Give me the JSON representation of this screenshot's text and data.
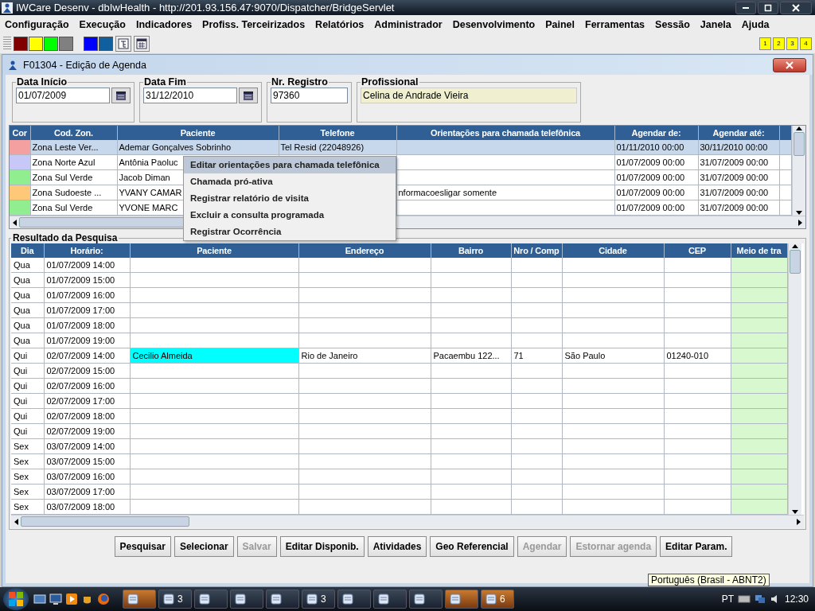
{
  "window": {
    "title": "IWCare Desenv - dbIwHealth - http://201.93.156.47:9070/Dispatcher/BridgeServlet"
  },
  "menu": [
    "Configuração",
    "Execução",
    "Indicadores",
    "Profiss. Terceirizados",
    "Relatórios",
    "Administrador",
    "Desenvolvimento",
    "Painel",
    "Ferramentas",
    "Sessão",
    "Janela",
    "Ajuda"
  ],
  "toolbar": {
    "swatches": [
      {
        "color": "#800000"
      },
      {
        "color": "#ffff00"
      },
      {
        "color": "#00ff00"
      },
      {
        "color": "#808080"
      },
      {
        "color": "#0000ff"
      },
      {
        "color": "#1060a0"
      }
    ],
    "pages": [
      "1",
      "2",
      "3",
      "4"
    ]
  },
  "inner_window": {
    "title": "F01304 - Edição de Agenda"
  },
  "filters": [
    {
      "label": "Data Início",
      "value": "01/07/2009",
      "kind": "date"
    },
    {
      "label": "Data Fim",
      "value": "31/12/2010",
      "kind": "date"
    },
    {
      "label": "Nr. Registro",
      "value": "97360",
      "kind": "text"
    },
    {
      "label": "Profissional",
      "value": "Celina de Andrade Vieira",
      "kind": "readonly"
    }
  ],
  "schedule_table": {
    "columns": [
      "Cor",
      "Cod. Zon.",
      "Paciente",
      "Telefone",
      "Orientações para chamada telefônica",
      "Agendar de:",
      "Agendar até:"
    ],
    "rows": [
      {
        "selected": true,
        "color": "#f4a0a0",
        "zone": "Zona Leste Ver...",
        "patient": "Ademar Gonçalves Sobrinho",
        "phone": "Tel Resid (22048926)",
        "notes": "",
        "from": "01/11/2010 00:00",
        "to": "30/11/2010 00:00"
      },
      {
        "selected": false,
        "color": "#c8c8f8",
        "zone": "Zona Norte Azul",
        "patient": "Antônia Paoluc",
        "phone": "",
        "notes": "",
        "from": "01/07/2009 00:00",
        "to": "31/07/2009 00:00"
      },
      {
        "selected": false,
        "color": "#90ee90",
        "zone": "Zona Sul Verde",
        "patient": "Jacob Diman",
        "phone": "",
        "notes": "",
        "from": "01/07/2009 00:00",
        "to": "31/07/2009 00:00"
      },
      {
        "selected": false,
        "color": "#ffc878",
        "zone": "Zona Sudoeste ...",
        "patient": "YVANY CAMAR",
        "phone": "",
        "notes": "nformacoesligar somente",
        "from": "01/07/2009 00:00",
        "to": "31/07/2009 00:00"
      },
      {
        "selected": false,
        "color": "#90ee90",
        "zone": "Zona Sul Verde",
        "patient": "YVONE MARC",
        "phone": "",
        "notes": "",
        "from": "01/07/2009 00:00",
        "to": "31/07/2009 00:00"
      }
    ]
  },
  "context_menu": [
    {
      "label": "Editar orientações para chamada telefônica",
      "selected": true
    },
    {
      "label": "Chamada pró-ativa",
      "selected": false
    },
    {
      "label": "Registrar relatório de visita",
      "selected": false
    },
    {
      "label": "Excluir a consulta programada",
      "selected": false
    },
    {
      "label": "Registrar Ocorrência",
      "selected": false
    }
  ],
  "results": {
    "title": "Resultado da Pesquisa",
    "columns": [
      "Dia",
      "Horário:",
      "Paciente",
      "Endereço",
      "Bairro",
      "Nro / Comp",
      "Cidade",
      "CEP",
      "Meio de tra"
    ],
    "rows": [
      {
        "day": "Qua",
        "time": "01/07/2009 14:00",
        "highlighted": false
      },
      {
        "day": "Qua",
        "time": "01/07/2009 15:00",
        "highlighted": false
      },
      {
        "day": "Qua",
        "time": "01/07/2009 16:00",
        "highlighted": false
      },
      {
        "day": "Qua",
        "time": "01/07/2009 17:00",
        "highlighted": false
      },
      {
        "day": "Qua",
        "time": "01/07/2009 18:00",
        "highlighted": false
      },
      {
        "day": "Qua",
        "time": "01/07/2009 19:00",
        "highlighted": false
      },
      {
        "day": "Qui",
        "time": "02/07/2009 14:00",
        "highlighted": true,
        "patient": "Cecilio Almeida",
        "address": "Rio de Janeiro",
        "district": "Pacaembu 122...",
        "number": "71",
        "city": "São Paulo",
        "zip": "01240-010"
      },
      {
        "day": "Qui",
        "time": "02/07/2009 15:00",
        "highlighted": false
      },
      {
        "day": "Qui",
        "time": "02/07/2009 16:00",
        "highlighted": false
      },
      {
        "day": "Qui",
        "time": "02/07/2009 17:00",
        "highlighted": false
      },
      {
        "day": "Qui",
        "time": "02/07/2009 18:00",
        "highlighted": false
      },
      {
        "day": "Qui",
        "time": "02/07/2009 19:00",
        "highlighted": false
      },
      {
        "day": "Sex",
        "time": "03/07/2009 14:00",
        "highlighted": false
      },
      {
        "day": "Sex",
        "time": "03/07/2009 15:00",
        "highlighted": false
      },
      {
        "day": "Sex",
        "time": "03/07/2009 16:00",
        "highlighted": false
      },
      {
        "day": "Sex",
        "time": "03/07/2009 17:00",
        "highlighted": false
      },
      {
        "day": "Sex",
        "time": "03/07/2009 18:00",
        "highlighted": false
      }
    ]
  },
  "buttons": [
    {
      "label": "Pesquisar",
      "disabled": false
    },
    {
      "label": "Selecionar",
      "disabled": false
    },
    {
      "label": "Salvar",
      "disabled": true
    },
    {
      "label": "Editar Disponib.",
      "disabled": false
    },
    {
      "label": "Atividades",
      "disabled": false
    },
    {
      "label": "Geo Referencial",
      "disabled": false
    },
    {
      "label": "Agendar",
      "disabled": true
    },
    {
      "label": "Estornar agenda",
      "disabled": true
    },
    {
      "label": "Editar Param.",
      "disabled": false
    }
  ],
  "tooltip": "Português (Brasil - ABNT2)",
  "taskbar": {
    "tasks": [
      {
        "active": true
      },
      {
        "active": false,
        "count": "3"
      },
      {
        "active": false
      },
      {
        "active": false
      },
      {
        "active": false
      },
      {
        "active": false,
        "count": "3"
      },
      {
        "active": false
      },
      {
        "active": false
      },
      {
        "active": false
      },
      {
        "active": true
      },
      {
        "active": true,
        "count": "6"
      }
    ],
    "language": "PT",
    "clock": "12:30"
  }
}
